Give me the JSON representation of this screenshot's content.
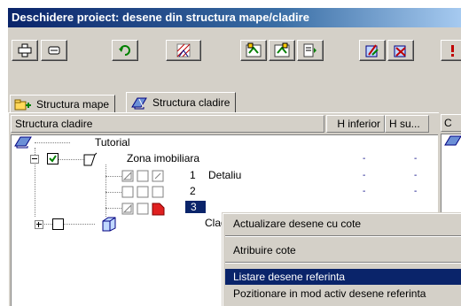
{
  "window": {
    "title": "Deschidere proiect: desene din structura mape/cladire"
  },
  "toolbar": {
    "buttons": [
      {
        "icon": "add-plus-icon"
      },
      {
        "icon": "minus-tool-icon"
      },
      {
        "icon": "refresh-icon"
      },
      {
        "icon": "hatch-drawing-icon"
      },
      {
        "icon": "insert-drawing-icon"
      },
      {
        "icon": "insert-drawing-2-icon"
      },
      {
        "icon": "drawing-list-icon"
      },
      {
        "icon": "building-edit-icon"
      },
      {
        "icon": "building-remove-icon"
      },
      {
        "icon": "more-icon"
      }
    ]
  },
  "tabs": [
    {
      "label": "Structura mape",
      "icon": "folder-structure-icon",
      "active": false
    },
    {
      "label": "Structura cladire",
      "icon": "building-structure-icon",
      "active": true
    }
  ],
  "grid": {
    "columns": [
      "Structura cladire",
      "H inferior",
      "H su..."
    ],
    "second_panel_header": "C"
  },
  "tree": {
    "root": {
      "label": "Tutorial"
    },
    "zone": {
      "label": "Zona imobiliara",
      "h_inf": "-",
      "h_sup": "-"
    },
    "levels": [
      {
        "number": "1",
        "label": "Detaliu",
        "h_inf": "-",
        "h_sup": "-"
      },
      {
        "number": "2",
        "label": "",
        "h_inf": "-",
        "h_sup": "-"
      },
      {
        "number": "3",
        "label": "",
        "selected": true
      }
    ],
    "building": {
      "label": "Clad"
    }
  },
  "context_menu": {
    "items": [
      {
        "label": "Actualizare desene cu cote",
        "highlighted": false
      },
      {
        "label": "Atribuire cote",
        "highlighted": false
      },
      {
        "label": "Listare desene referinta",
        "highlighted": true
      },
      {
        "label": "Pozitionare in mod activ desene referinta",
        "highlighted": false
      }
    ]
  },
  "colors": {
    "titlebar_start": "#0a246a",
    "titlebar_end": "#a6caf0",
    "selection": "#0a246a",
    "chrome": "#d4d0c8"
  }
}
